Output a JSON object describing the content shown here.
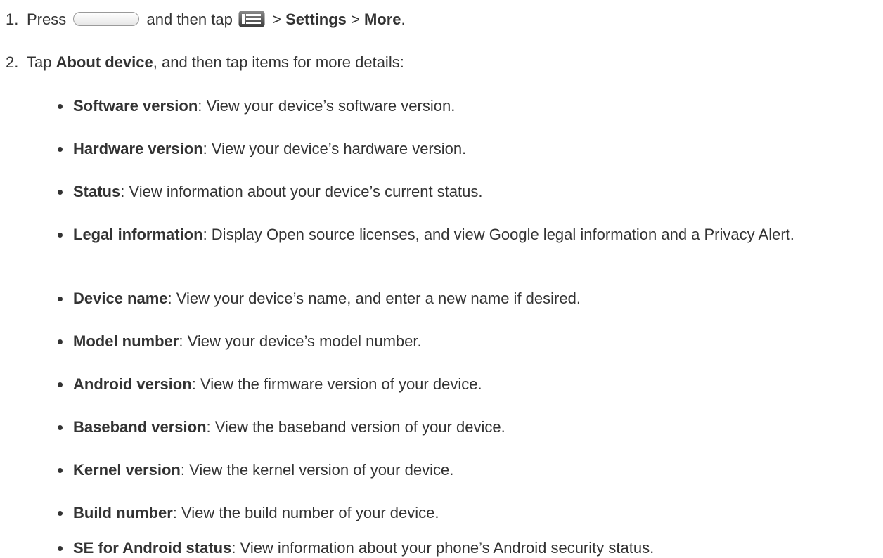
{
  "steps": [
    {
      "number": "1.",
      "t1": "Press",
      "t2": "and then tap",
      "t3": ">",
      "b1": "Settings",
      "t4": ">",
      "b2": "More",
      "t5": "."
    },
    {
      "number": "2.",
      "t1": "Tap",
      "b1": "About device",
      "t2": ", and then tap items for more details:"
    }
  ],
  "icons": {
    "home_key": "home-key-icon",
    "menu_key": "menu-key-icon"
  },
  "items": [
    {
      "term": "Software version",
      "desc": ": View your device’s software version."
    },
    {
      "term": "Hardware version",
      "desc": ": View your device’s hardware version."
    },
    {
      "term": "Status",
      "desc": ": View information about your device’s current status."
    },
    {
      "term": "Legal information",
      "desc": ": Display Open source licenses, and view Google legal information and a Privacy Alert."
    },
    {
      "term": "Device name",
      "desc": ": View your device’s name, and enter a new name if desired."
    },
    {
      "term": "Model number",
      "desc": ": View your device’s model number."
    },
    {
      "term": "Android version",
      "desc": ": View the firmware version of your device."
    },
    {
      "term": "Baseband version",
      "desc": ": View the baseband version of your device."
    },
    {
      "term": "Kernel version",
      "desc": ": View the kernel version of your device."
    },
    {
      "term": "Build number",
      "desc": ": View the build number of your device."
    },
    {
      "term": "SE for Android status",
      "desc": ": View information about your phone’s Android security status."
    }
  ]
}
